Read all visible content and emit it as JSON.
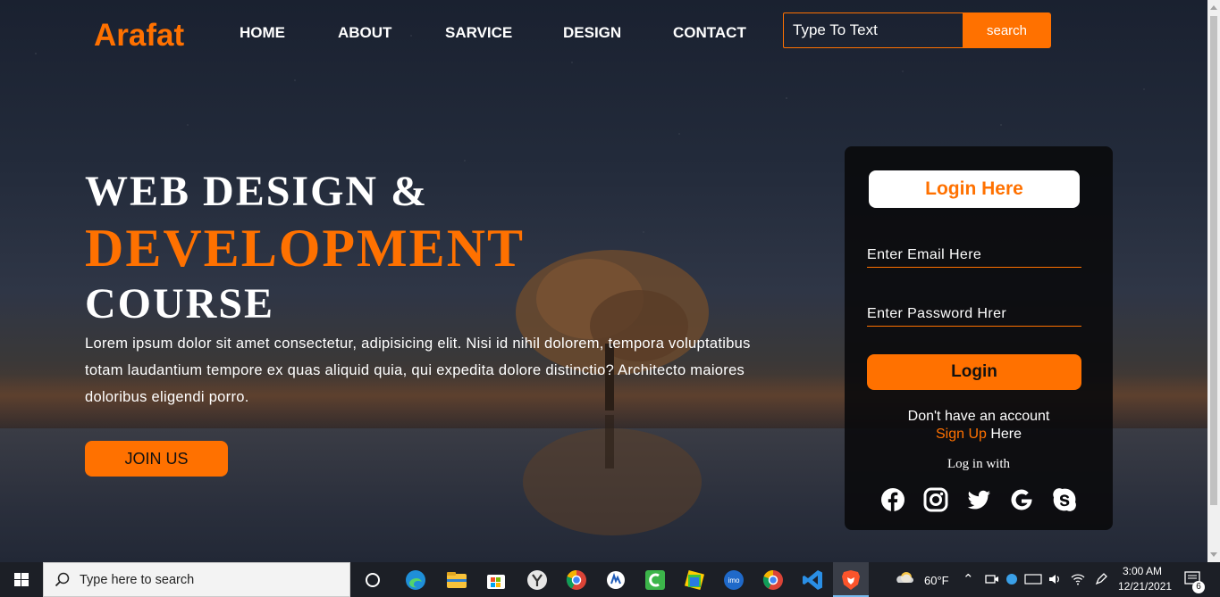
{
  "nav": {
    "brand": "Arafat",
    "links": [
      "HOME",
      "ABOUT",
      "SARVICE",
      "DESIGN",
      "CONTACT"
    ],
    "search_placeholder": "Type To Text",
    "search_button": "search"
  },
  "hero": {
    "line1": "WEB DESIGN &",
    "line2": "DEVELOPMENT",
    "line3": "COURSE",
    "paragraph": "Lorem ipsum dolor sit amet consectetur, adipisicing elit. Nisi id nihil dolorem, tempora voluptatibus totam laudantium tempore ex quas aliquid quia, qui expedita dolore distinctio? Architecto maiores doloribus eligendi porro.",
    "join_button": "JOIN US"
  },
  "login": {
    "title": "Login Here",
    "email_placeholder": "Enter Email Here",
    "password_placeholder": "Enter Password Hrer",
    "button": "Login",
    "no_account": "Don't have an account",
    "signup_link": "Sign Up",
    "signup_suffix": " Here",
    "login_with": "Log in with",
    "socials": [
      "facebook-icon",
      "instagram-icon",
      "twitter-icon",
      "google-icon",
      "skype-icon"
    ]
  },
  "taskbar": {
    "search_placeholder": "Type here to search",
    "weather": "60°F",
    "time": "3:00 AM",
    "date": "12/21/2021",
    "notification_count": "6"
  },
  "colors": {
    "accent": "#ff7100",
    "card_bg": "#0a0a0c"
  }
}
